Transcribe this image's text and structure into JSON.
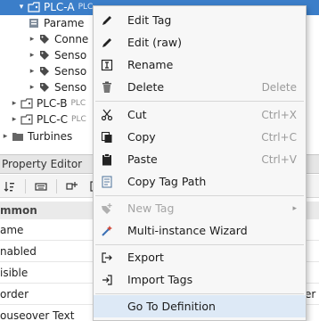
{
  "tree": {
    "rows": [
      {
        "label": "PLC-A",
        "sub": "PLC",
        "arrow": "▾",
        "icon": "folder-tag-icon",
        "selected": true
      },
      {
        "label": "Parame",
        "sub": "",
        "arrow": "",
        "icon": "udt-member-icon",
        "selected": false
      },
      {
        "label": "Conne",
        "sub": "",
        "arrow": "▸",
        "icon": "tag-icon",
        "selected": false
      },
      {
        "label": "Senso",
        "sub": "",
        "arrow": "▸",
        "icon": "tag-icon",
        "selected": false
      },
      {
        "label": "Senso",
        "sub": "",
        "arrow": "▸",
        "icon": "tag-icon",
        "selected": false
      },
      {
        "label": "Senso",
        "sub": "",
        "arrow": "▸",
        "icon": "tag-icon",
        "selected": false
      },
      {
        "label": "PLC-B",
        "sub": "PLC",
        "arrow": "▸",
        "icon": "folder-tag-icon",
        "selected": false
      },
      {
        "label": "PLC-C",
        "sub": "PLC",
        "arrow": "▸",
        "icon": "folder-tag-icon",
        "selected": false
      },
      {
        "label": "Turbines",
        "sub": "",
        "arrow": "▸",
        "icon": "folder-icon",
        "selected": false
      }
    ]
  },
  "property_editor": {
    "title": "Property Editor",
    "section": "mmon",
    "rows": [
      {
        "name": "ame",
        "value": ""
      },
      {
        "name": "nabled",
        "value": ""
      },
      {
        "name": "isible",
        "value": ""
      },
      {
        "name": "order",
        "value": "er"
      },
      {
        "name": "ouseover Text",
        "value": ""
      }
    ]
  },
  "menu": {
    "items": [
      {
        "id": "edit-tag",
        "label": "Edit Tag",
        "shortcut": "",
        "icon": "pencil-icon",
        "disabled": false
      },
      {
        "id": "edit-raw",
        "label": "Edit (raw)",
        "shortcut": "",
        "icon": "pencil-icon",
        "disabled": false
      },
      {
        "id": "rename",
        "label": "Rename",
        "shortcut": "",
        "icon": "rename-icon",
        "disabled": false
      },
      {
        "id": "delete",
        "label": "Delete",
        "shortcut": "Delete",
        "icon": "trash-icon",
        "disabled": false
      },
      {
        "id": "cut",
        "label": "Cut",
        "shortcut": "Ctrl+X",
        "icon": "scissors-icon",
        "disabled": false
      },
      {
        "id": "copy",
        "label": "Copy",
        "shortcut": "Ctrl+C",
        "icon": "copy-icon",
        "disabled": false
      },
      {
        "id": "paste",
        "label": "Paste",
        "shortcut": "Ctrl+V",
        "icon": "clipboard-icon",
        "disabled": false
      },
      {
        "id": "copy-tag-path",
        "label": "Copy Tag Path",
        "shortcut": "",
        "icon": "copy-path-icon",
        "disabled": false
      },
      {
        "id": "new-tag",
        "label": "New Tag",
        "shortcut": "",
        "icon": "new-tag-icon",
        "disabled": true
      },
      {
        "id": "multi-instance-wizard",
        "label": "Multi-instance Wizard",
        "shortcut": "",
        "icon": "wizard-icon",
        "disabled": false
      },
      {
        "id": "export",
        "label": "Export",
        "shortcut": "",
        "icon": "export-icon",
        "disabled": false
      },
      {
        "id": "import-tags",
        "label": "Import Tags",
        "shortcut": "",
        "icon": "import-icon",
        "disabled": false
      },
      {
        "id": "go-to-definition",
        "label": "Go To Definition",
        "shortcut": "",
        "icon": "",
        "disabled": false
      }
    ],
    "submenu_arrow": "▸"
  },
  "colors": {
    "selection": "#3b7ec9",
    "menu_highlight": "#dde9f6",
    "disabled_text": "#a5a5a5"
  }
}
